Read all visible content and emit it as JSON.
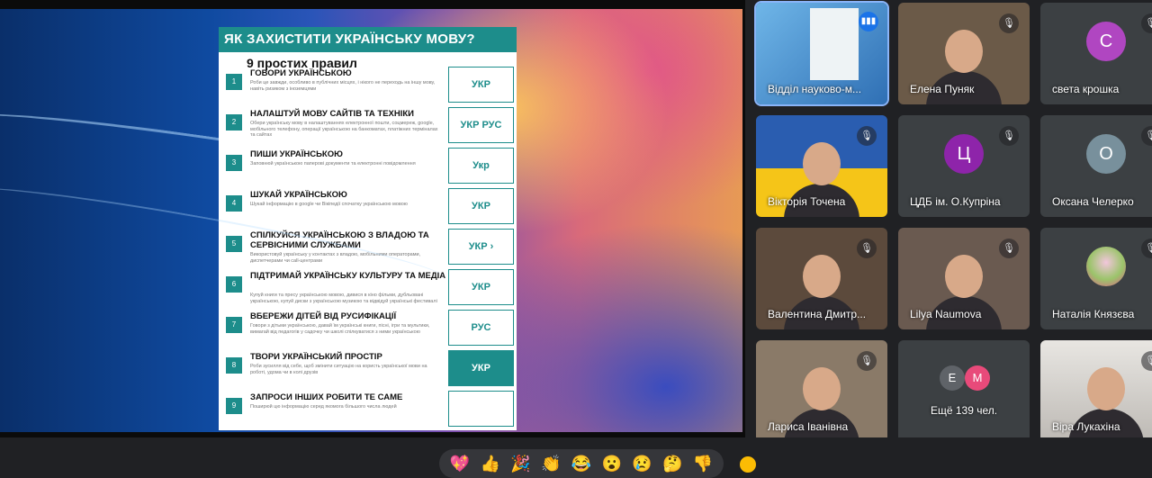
{
  "presentation": {
    "slide_title": "ЯК ЗАХИСТИТИ УКРАЇНСЬКУ МОВУ?",
    "slide_subtitle": "9 простих правил",
    "rules": [
      {
        "num": "1",
        "title": "ГОВОРИ УКРАЇНСЬКОЮ",
        "desc": "Роби це завжди, особливо в публічних місцях, і нікого не переходь на іншу мову, навіть ризиком з іноземцями",
        "pic": "УКР"
      },
      {
        "num": "2",
        "title": "НАЛАШТУЙ МОВУ САЙТІВ ТА ТЕХНІКИ",
        "desc": "Обери українську мову в налаштуваннях електронної пошти, соцмереж, google, мобільного телефону, операції українською на банкоматах, платіжних терміналах та сайтах",
        "pic": "УКР РУС"
      },
      {
        "num": "3",
        "title": "ПИШИ УКРАЇНСЬКОЮ",
        "desc": "Заповнюй українською паперові документи та електронні повідомлення",
        "pic": "Укр"
      },
      {
        "num": "4",
        "title": "ШУКАЙ УКРАЇНСЬКОЮ",
        "desc": "Шукай інформацію в google чи Вікіпедії спочатку українською мовою",
        "pic": "УКР"
      },
      {
        "num": "5",
        "title": "СПІЛКУЙСЯ УКРАЇНСЬКОЮ З ВЛАДОЮ ТА СЕРВІСНИМИ СЛУЖБАМИ",
        "desc": "Використовуй українську у контактах з владою, мобільними операторами, диспетчерами чи call-центрами",
        "pic": "УКР ›"
      },
      {
        "num": "6",
        "title": "ПІДТРИМАЙ УКРАЇНСЬКУ КУЛЬТУРУ ТА МЕДІА",
        "desc": "Купуй книги та пресу українською мовою, дивися в кіно фільми, дубльовані українською, купуй диски з українською музикою та відвідуй українські фестивалі",
        "pic": "УКР"
      },
      {
        "num": "7",
        "title": "ВБЕРЕЖИ ДІТЕЙ ВІД РУСИФІКАЦІЇ",
        "desc": "Говори з дітьми українською, давай їм українські книги, пісні, ігри та мультики, вимагай від педагогів у садочку чи школі спілкуватися з ними українською",
        "pic": "РУС"
      },
      {
        "num": "8",
        "title": "ТВОРИ УКРАЇНСЬКИЙ ПРОСТІР",
        "desc": "Роби зусилля від себе, щоб змінити ситуацію на користь української мови на роботі, удома чи в колі друзів",
        "pic": "УКР"
      },
      {
        "num": "9",
        "title": "ЗАПРОСИ ІНШИХ РОБИТИ ТЕ САМЕ",
        "desc": "Поширюй цю інформацію серед якомога більшого числа людей",
        "pic": ""
      }
    ]
  },
  "participants": [
    {
      "name": "Відділ науково-м...",
      "type": "screen",
      "speaking": true
    },
    {
      "name": "Елена Пуняк",
      "type": "video"
    },
    {
      "name": "света крошка",
      "type": "avatar",
      "initial": "С",
      "color": "#b046c1"
    },
    {
      "name": "Вікторія Точена",
      "type": "video"
    },
    {
      "name": "ЦДБ ім. О.Купріна",
      "type": "avatar",
      "initial": "Ц",
      "color": "#8e24aa"
    },
    {
      "name": "Оксана Челерко",
      "type": "avatar",
      "initial": "О",
      "color": "#78909c"
    },
    {
      "name": "Валентина Дмитр...",
      "type": "video"
    },
    {
      "name": "Lilya Naumova",
      "type": "video"
    },
    {
      "name": "Наталія Князєва",
      "type": "avatar-image"
    },
    {
      "name": "Лариса Іванівна",
      "type": "video"
    },
    {
      "name": "Ещё 139 чел.",
      "type": "overflow",
      "initials": [
        "Е",
        "М"
      ]
    },
    {
      "name": "Віра Лукахіна",
      "type": "video"
    }
  ],
  "reactions": [
    "💖",
    "👍",
    "🎉",
    "👏",
    "😂",
    "😮",
    "😢",
    "🤔",
    "👎"
  ],
  "mic_icon": "🎙̸",
  "colors": {
    "accent": "#1d8d8b",
    "tile": "#3c4043",
    "bg": "#202124",
    "speaking": "#8ab4f8"
  }
}
